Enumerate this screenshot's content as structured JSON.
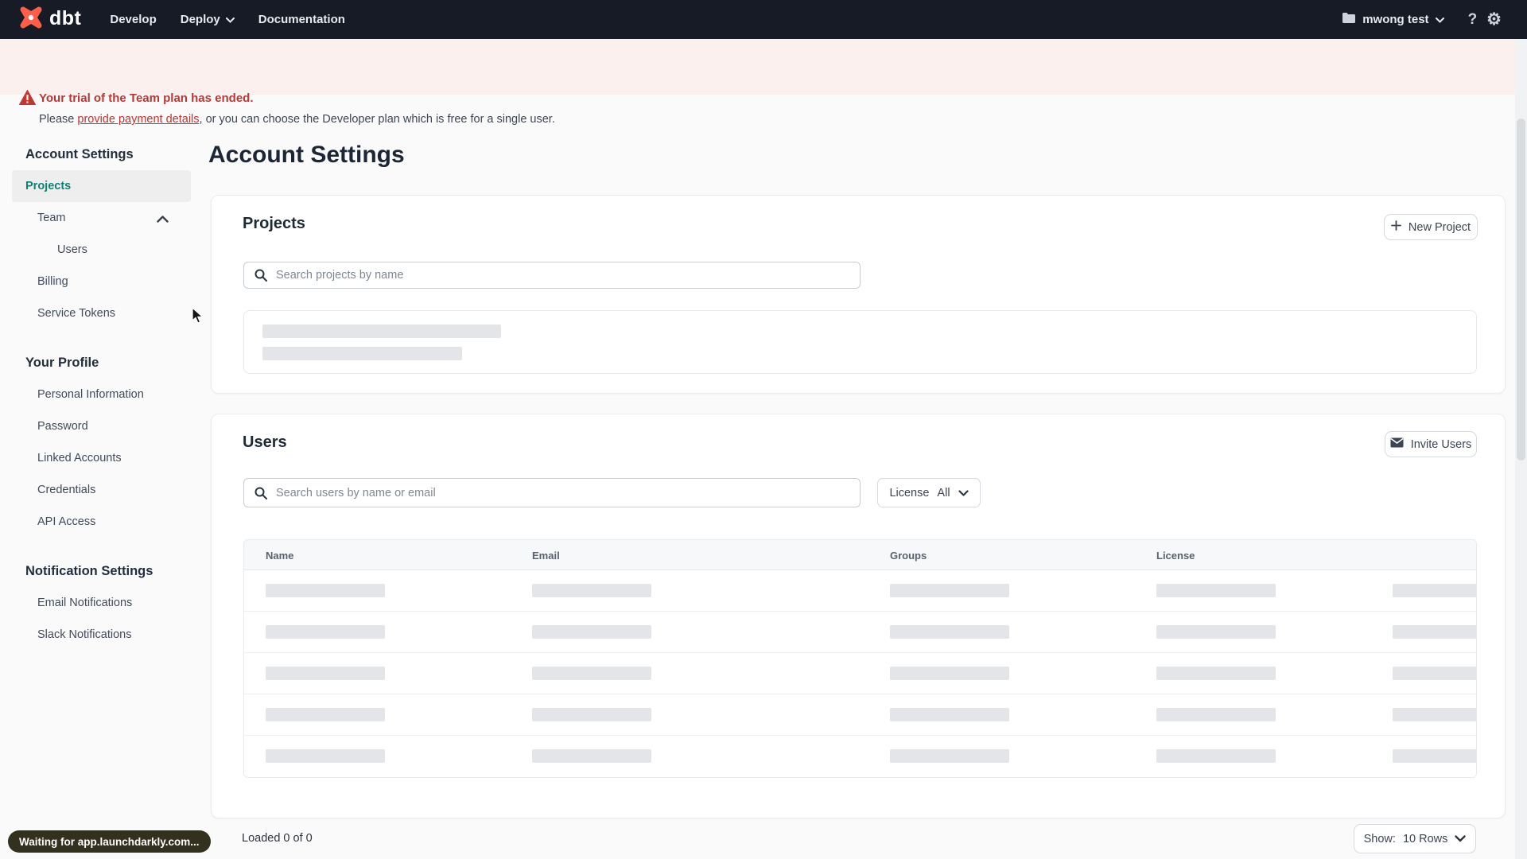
{
  "nav": {
    "logo_text": "dbt",
    "items": {
      "develop": "Develop",
      "deploy": "Deploy",
      "documentation": "Documentation"
    },
    "account_label": "mwong test",
    "help_glyph": "?"
  },
  "banner": {
    "title": "Your trial of the Team plan has ended.",
    "body_prefix": "Please ",
    "link_text": "provide payment details",
    "body_suffix": ", or you can choose the Developer plan which is free for a single user."
  },
  "sidebar": {
    "sections": [
      {
        "heading": "Account Settings",
        "items": [
          {
            "label": "Projects"
          },
          {
            "label": "Team"
          },
          {
            "label": "Users"
          },
          {
            "label": "Billing"
          },
          {
            "label": "Service Tokens"
          }
        ]
      },
      {
        "heading": "Your Profile",
        "items": [
          {
            "label": "Personal Information"
          },
          {
            "label": "Password"
          },
          {
            "label": "Linked Accounts"
          },
          {
            "label": "Credentials"
          },
          {
            "label": "API Access"
          }
        ]
      },
      {
        "heading": "Notification Settings",
        "items": [
          {
            "label": "Email Notifications"
          },
          {
            "label": "Slack Notifications"
          }
        ]
      }
    ]
  },
  "main": {
    "title": "Account Settings",
    "projects_card": {
      "heading": "Projects",
      "new_project_button": "New Project",
      "search_placeholder": "Search projects by name"
    },
    "users_card": {
      "heading": "Users",
      "invite_button": "Invite Users",
      "search_placeholder": "Search users by name or email",
      "license_filter": {
        "label": "License",
        "value": "All"
      },
      "table": {
        "columns": [
          "Name",
          "Email",
          "Groups",
          "License"
        ],
        "skeleton_rows": 5
      },
      "loaded_text": "Loaded 0 of 0",
      "show_label": "Show:",
      "show_value": "10 Rows"
    }
  },
  "status_tooltip": "Waiting for app.launchdarkly.com...",
  "colors": {
    "nav_bg": "#171b26",
    "brand_orange": "#ff5e49",
    "banner_bg": "#fcf0ee",
    "alert_red": "#bf352f",
    "active_teal": "#0c8275",
    "skeleton_gray": "#e3e5e9"
  }
}
